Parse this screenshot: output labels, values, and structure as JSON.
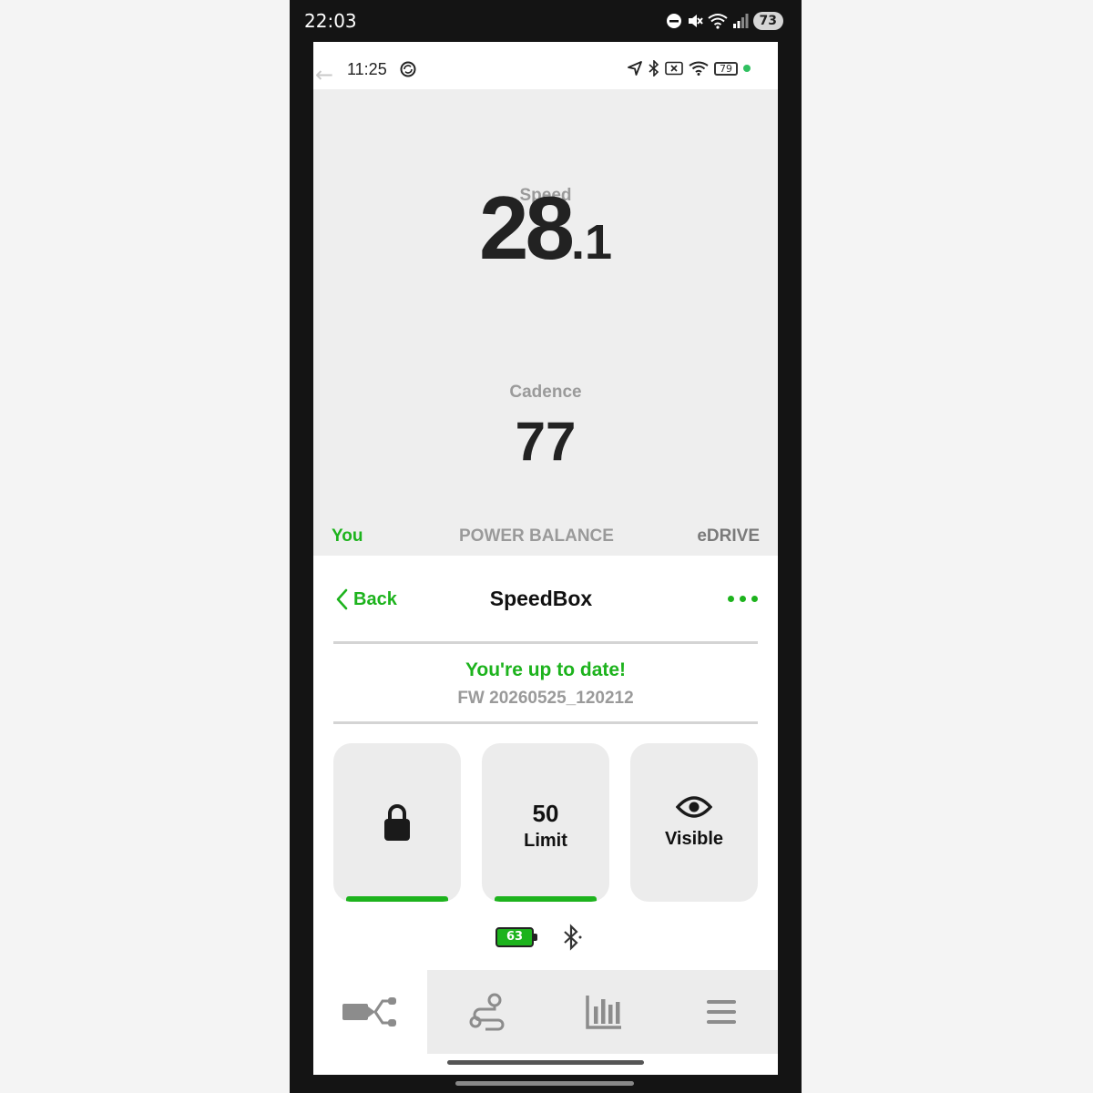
{
  "outer_status": {
    "time": "22:03",
    "battery": "73",
    "signal_label": "5"
  },
  "inner_status": {
    "time": "11:25",
    "battery": "79"
  },
  "ride": {
    "speed_label": "Speed",
    "speed_int": "28",
    "speed_dec": ".1",
    "cadence_label": "Cadence",
    "cadence_value": "77",
    "tabs": [
      "You",
      "POWER BALANCE",
      "eDRIVE"
    ],
    "active_tab": "You",
    "progress": 0.345
  },
  "header": {
    "back_label": "Back",
    "title": "SpeedBox"
  },
  "update": {
    "title": "You're up to date!",
    "firmware": "FW 20260525_120212"
  },
  "cards": {
    "limit_value": "50",
    "limit_label": "Limit",
    "visible_label": "Visible"
  },
  "device": {
    "battery": "63"
  },
  "colors": {
    "accent": "#1db31d",
    "muted": "#9a9a9a",
    "panel_bg": "#eeeeee"
  },
  "bottom_nav": [
    "device-connect-icon",
    "route-icon",
    "stats-icon",
    "menu-icon"
  ]
}
